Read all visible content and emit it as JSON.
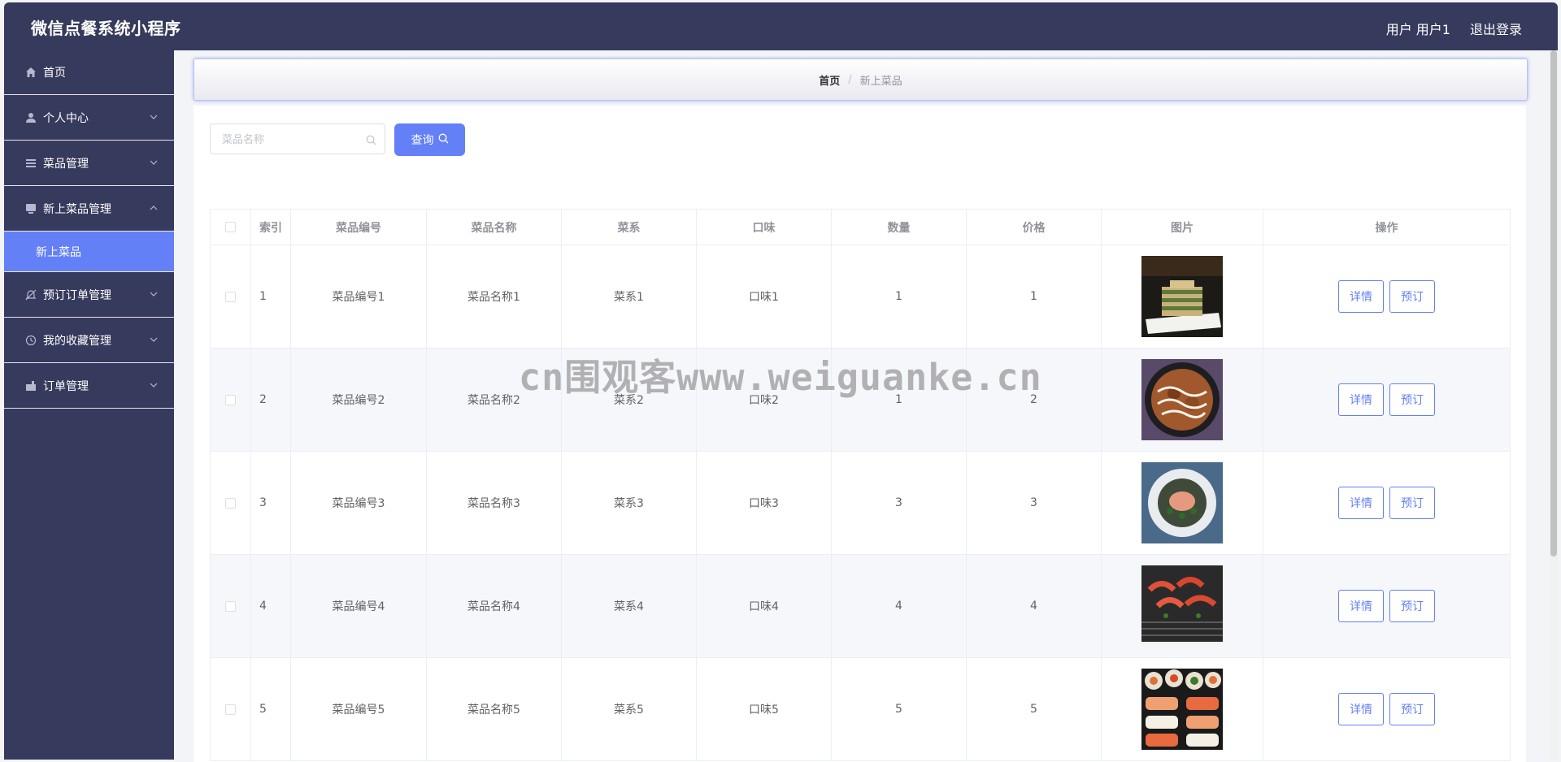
{
  "app": {
    "title": "微信点餐系统小程序"
  },
  "header": {
    "user_label": "用户 用户1",
    "logout_label": "退出登录"
  },
  "sidebar": {
    "items": [
      {
        "label": "首页",
        "icon": "home-icon"
      },
      {
        "label": "个人中心",
        "icon": "user-icon"
      },
      {
        "label": "菜品管理",
        "icon": "list-icon"
      },
      {
        "label": "新上菜品管理",
        "icon": "monitor-icon",
        "expanded": true,
        "children": [
          {
            "label": "新上菜品",
            "active": true
          }
        ]
      },
      {
        "label": "预订订单管理",
        "icon": "bell-off-icon"
      },
      {
        "label": "我的收藏管理",
        "icon": "clock-icon"
      },
      {
        "label": "订单管理",
        "icon": "briefcase-icon"
      }
    ]
  },
  "breadcrumb": {
    "home": "首页",
    "separator": "/",
    "current": "新上菜品"
  },
  "search": {
    "placeholder": "菜品名称",
    "value": "",
    "button_label": "查询"
  },
  "table": {
    "columns": [
      "",
      "索引",
      "菜品编号",
      "菜品名称",
      "菜系",
      "口味",
      "数量",
      "价格",
      "图片",
      "操作"
    ],
    "rows": [
      {
        "index": "1",
        "code": "菜品编号1",
        "name": "菜品名称1",
        "cuisine": "菜系1",
        "flavor": "口味1",
        "qty": "1",
        "price": "1",
        "image": "layered-cake-dish"
      },
      {
        "index": "2",
        "code": "菜品编号2",
        "name": "菜品名称2",
        "cuisine": "菜系2",
        "flavor": "口味2",
        "qty": "1",
        "price": "2",
        "image": "okonomiyaki-dish"
      },
      {
        "index": "3",
        "code": "菜品编号3",
        "name": "菜品名称3",
        "cuisine": "菜系3",
        "flavor": "口味3",
        "qty": "3",
        "price": "3",
        "image": "plated-salmon-dish"
      },
      {
        "index": "4",
        "code": "菜品编号4",
        "name": "菜品名称4",
        "cuisine": "菜系4",
        "flavor": "口味4",
        "qty": "4",
        "price": "4",
        "image": "grilled-shrimp-dish"
      },
      {
        "index": "5",
        "code": "菜品编号5",
        "name": "菜品名称5",
        "cuisine": "菜系5",
        "flavor": "口味5",
        "qty": "5",
        "price": "5",
        "image": "sushi-platter-dish"
      }
    ],
    "actions": {
      "detail": "详情",
      "reserve": "预订"
    }
  },
  "watermark": "cn围观客www.weiguanke.cn",
  "colors": {
    "header_bg": "#363a5c",
    "accent": "#6380f6",
    "content_bg": "#ffffff"
  }
}
